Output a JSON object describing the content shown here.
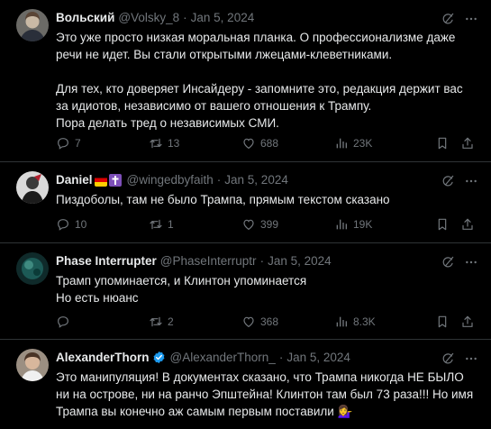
{
  "tweets": [
    {
      "display_name": "Вольский",
      "handle": "@Volsky_8",
      "date": "Jan 5, 2024",
      "paragraphs": [
        "Это уже просто низкая моральная планка. О профессионализме даже речи не идет. Вы стали открытыми лжецами-клеветниками.",
        "",
        "Для тех, кто доверяет Инсайдеру - запомните это, редакция держит вас за идиотов, независимо от вашего отношения к Трампу.",
        "Пора делать тред о независимых СМИ."
      ],
      "replies": "7",
      "reposts": "13",
      "likes": "688",
      "views": "23K"
    },
    {
      "display_name": "Daniel",
      "handle": "@wingedbyfaith",
      "date": "Jan 5, 2024",
      "paragraphs": [
        "Пиздоболы, там не было Трампа, прямым текстом сказано"
      ],
      "replies": "10",
      "reposts": "1",
      "likes": "399",
      "views": "19K"
    },
    {
      "display_name": "Phase Interrupter",
      "handle": "@PhaseInterruptr",
      "date": "Jan 5, 2024",
      "paragraphs": [
        "Трамп упоминается, и Клинтон упоминается",
        "Но есть нюанс"
      ],
      "replies": "",
      "reposts": "2",
      "likes": "368",
      "views": "8.3K"
    },
    {
      "display_name": "AlexanderThorn",
      "handle": "@AlexanderThorn_",
      "date": "Jan 5, 2024",
      "paragraphs": [
        "Это манипуляция! В документах сказано, что Трампа никогда НЕ БЫЛО ни на острове, ни на ранчо Эпштейна! Клинтон там был 73 раза!!! Но имя Трампа вы конечно аж самым первым поставили 💁‍♀️"
      ]
    }
  ],
  "separator": "·",
  "colors": {
    "background": "#000000",
    "border": "#2f3336",
    "muted": "#71767b",
    "text": "#e7e9ea",
    "verified": "#1d9bf0"
  },
  "icons": [
    "grok-icon",
    "more-icon",
    "reply-icon",
    "repost-icon",
    "like-icon",
    "views-icon",
    "bookmark-icon",
    "share-icon",
    "verified-badge-icon",
    "german-flag-icon",
    "cross-icon"
  ]
}
